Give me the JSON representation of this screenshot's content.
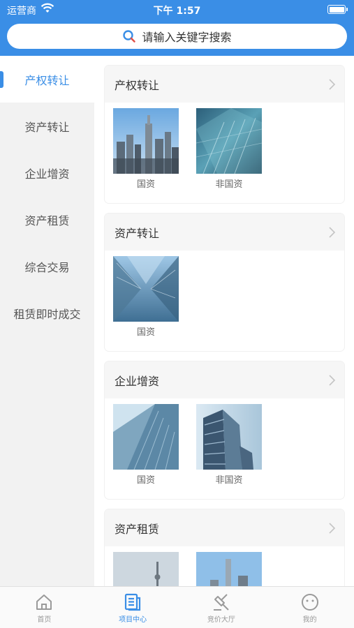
{
  "status": {
    "carrier": "运营商",
    "time": "下午 1:57"
  },
  "search": {
    "placeholder": "请输入关键字搜索"
  },
  "sidebar": {
    "items": [
      {
        "label": "产权转让",
        "active": true
      },
      {
        "label": "资产转让"
      },
      {
        "label": "企业增资"
      },
      {
        "label": "资产租赁"
      },
      {
        "label": "综合交易"
      },
      {
        "label": "租赁即时成交"
      }
    ]
  },
  "cards": [
    {
      "title": "产权转让",
      "items": [
        {
          "label": "国资"
        },
        {
          "label": "非国资"
        }
      ]
    },
    {
      "title": "资产转让",
      "items": [
        {
          "label": "国资"
        }
      ]
    },
    {
      "title": "企业增资",
      "items": [
        {
          "label": "国资"
        },
        {
          "label": "非国资"
        }
      ]
    },
    {
      "title": "资产租赁",
      "items": []
    }
  ],
  "tabbar": {
    "tabs": [
      {
        "label": "首页",
        "icon": "home-icon"
      },
      {
        "label": "项目中心",
        "icon": "document-icon",
        "active": true
      },
      {
        "label": "竞价大厅",
        "icon": "gavel-icon"
      },
      {
        "label": "我的",
        "icon": "smiley-icon"
      }
    ]
  },
  "colors": {
    "accent": "#3a8ee6",
    "sidebar_bg": "#f2f2f2",
    "card_head_bg": "#f6f6f6"
  }
}
